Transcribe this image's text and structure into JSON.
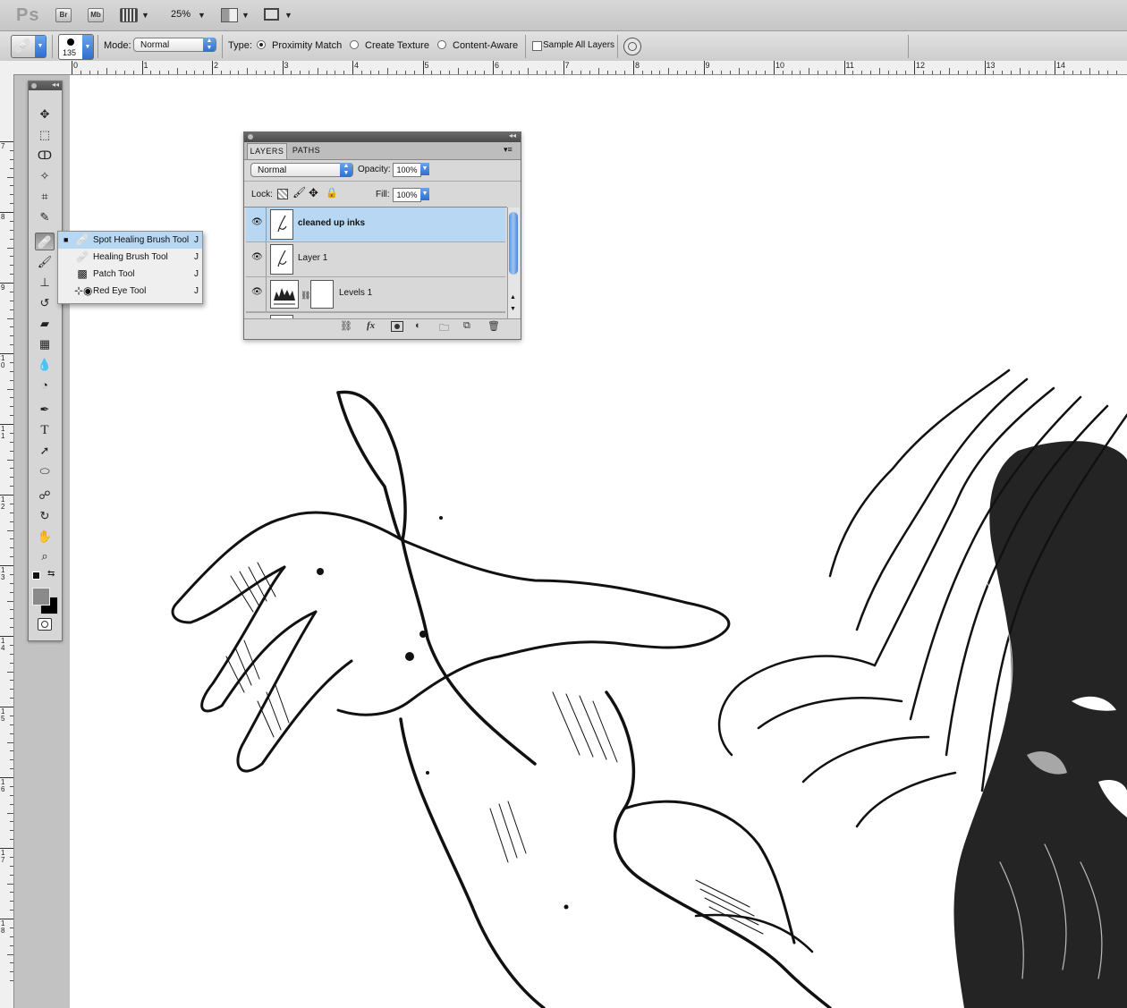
{
  "app_bar": {
    "logo": "Ps",
    "bridge_label": "Br",
    "minibridge_label": "Mb",
    "zoom": "25%"
  },
  "options_bar": {
    "brush_size": "135",
    "mode_label": "Mode:",
    "mode_value": "Normal",
    "type_label": "Type:",
    "type_options": [
      "Proximity Match",
      "Create Texture",
      "Content-Aware"
    ],
    "type_selected": "Proximity Match",
    "sample_all_layers": "Sample All Layers"
  },
  "ruler": {
    "h_ticks": [
      "0",
      "1",
      "2",
      "3",
      "4",
      "5",
      "6",
      "7",
      "8",
      "9",
      "10",
      "11",
      "12",
      "13",
      "14"
    ],
    "v_ticks": [
      "7",
      "8",
      "9",
      "10",
      "11",
      "12",
      "13",
      "14",
      "15",
      "16",
      "17",
      "18"
    ]
  },
  "tools_flyout": {
    "items": [
      {
        "name": "Spot Healing Brush Tool",
        "key": "J",
        "icon": "spot-healing-brush-icon"
      },
      {
        "name": "Healing Brush Tool",
        "key": "J",
        "icon": "healing-brush-icon"
      },
      {
        "name": "Patch Tool",
        "key": "J",
        "icon": "patch-icon"
      },
      {
        "name": "Red Eye Tool",
        "key": "J",
        "icon": "red-eye-icon"
      }
    ]
  },
  "layers_panel": {
    "tabs": [
      "LAYERS",
      "PATHS"
    ],
    "active_tab": "LAYERS",
    "blend_mode": "Normal",
    "opacity_label": "Opacity:",
    "opacity": "100%",
    "lock_label": "Lock:",
    "fill_label": "Fill:",
    "fill": "100%",
    "layers": [
      {
        "name": "cleaned up inks",
        "selected": true
      },
      {
        "name": "Layer 1",
        "selected": false
      },
      {
        "name": "Levels 1",
        "selected": false
      }
    ]
  },
  "colors": {
    "selection_blue": "#b7d7f3",
    "accent_blue": "#2f6ed0"
  }
}
